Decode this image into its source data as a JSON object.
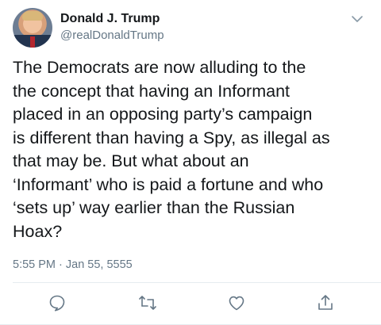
{
  "author": {
    "name": "Donald J. Trump",
    "handle": "@realDonaldTrump"
  },
  "tweet": {
    "lines": [
      "The Democrats are now alluding to the",
      "the concept that having an Informant",
      "placed in an opposing party’s campaign",
      "is different than having a Spy, as illegal as",
      "that may be. But what about an",
      "‘Informant’ who is paid a fortune and who",
      "‘sets up’ way earlier than the Russian",
      "Hoax?"
    ],
    "timestamp": "5:55 PM · Jan 55, 5555"
  },
  "icons": {
    "menu": "chevron-down-icon",
    "reply": "reply-icon",
    "retweet": "retweet-icon",
    "like": "heart-icon",
    "share": "share-icon"
  },
  "colors": {
    "text": "#14171a",
    "secondary": "#657786",
    "divider": "#e6ecf0"
  }
}
